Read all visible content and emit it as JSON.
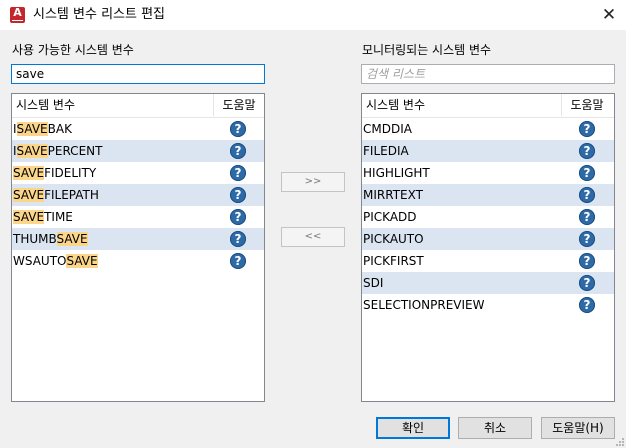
{
  "window": {
    "title": "시스템 변수 리스트 편집",
    "close_glyph": "✕"
  },
  "left": {
    "label": "사용 가능한 시스템 변수",
    "search_value": "save",
    "col_name": "시스템 변수",
    "col_help": "도움말",
    "rows": [
      {
        "pre": "I",
        "match": "SAVE",
        "post": "BAK"
      },
      {
        "pre": "I",
        "match": "SAVE",
        "post": "PERCENT"
      },
      {
        "pre": "",
        "match": "SAVE",
        "post": "FIDELITY"
      },
      {
        "pre": "",
        "match": "SAVE",
        "post": "FILEPATH"
      },
      {
        "pre": "",
        "match": "SAVE",
        "post": "TIME"
      },
      {
        "pre": "THUMB",
        "match": "SAVE",
        "post": ""
      },
      {
        "pre": "WSAUTO",
        "match": "SAVE",
        "post": ""
      }
    ]
  },
  "right": {
    "label": "모니터링되는 시스템 변수",
    "search_placeholder": "검색 리스트",
    "col_name": "시스템 변수",
    "col_help": "도움말",
    "rows": [
      "CMDDIA",
      "FILEDIA",
      "HIGHLIGHT",
      "MIRRTEXT",
      "PICKADD",
      "PICKAUTO",
      "PICKFIRST",
      "SDI",
      "SELECTIONPREVIEW"
    ]
  },
  "buttons": {
    "add": ">>",
    "remove": "<<",
    "ok": "확인",
    "cancel": "취소",
    "help": "도움말(H)"
  },
  "help_glyph": "?",
  "colors": {
    "highlight": "#fbd58a",
    "alt_row": "#dbe5f1",
    "help_icon": "#2d6aa6",
    "accent": "#0078d7"
  }
}
